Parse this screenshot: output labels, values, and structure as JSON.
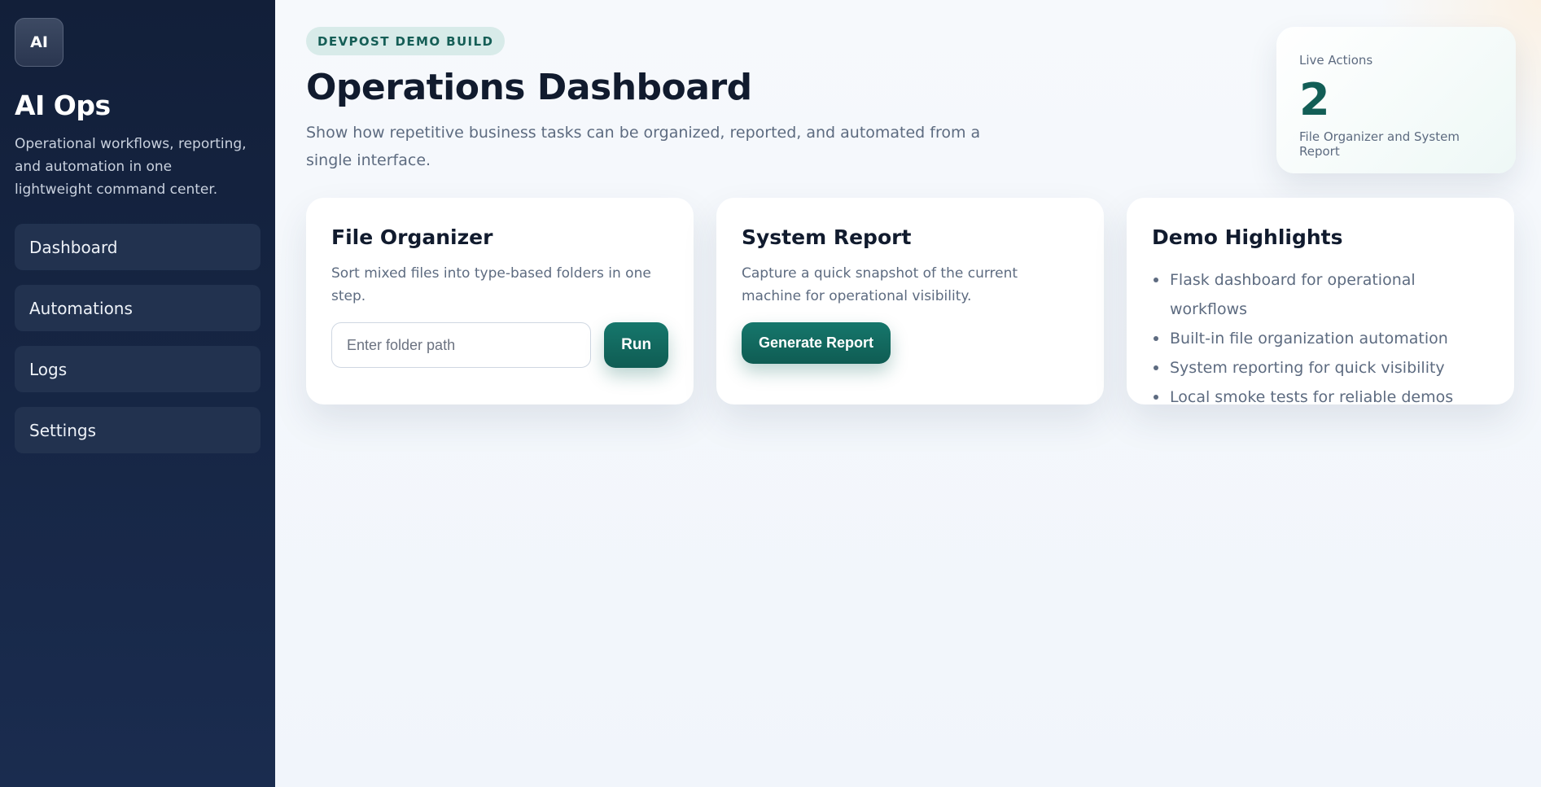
{
  "sidebar": {
    "logo": "AI",
    "title": "AI Ops",
    "description": "Operational workflows, reporting, and automation in one lightweight command center.",
    "nav": [
      "Dashboard",
      "Automations",
      "Logs",
      "Settings"
    ]
  },
  "header": {
    "badge": "DEVPOST DEMO BUILD",
    "title": "Operations Dashboard",
    "description": "Show how repetitive business tasks can be organized, reported, and automated from a single interface."
  },
  "stat": {
    "label": "Live Actions",
    "value": "2",
    "sub": "File Organizer and System Report"
  },
  "file_organizer": {
    "title": "File Organizer",
    "description": "Sort mixed files into type-based folders in one step.",
    "input_placeholder": "Enter folder path",
    "input_value": "",
    "button": "Run"
  },
  "system_report": {
    "title": "System Report",
    "description": "Capture a quick snapshot of the current machine for operational visibility.",
    "button": "Generate Report"
  },
  "highlights": {
    "title": "Demo Highlights",
    "items": [
      "Flask dashboard for operational workflows",
      "Built-in file organization automation",
      "System reporting for quick visibility",
      "Local smoke tests for reliable demos"
    ]
  },
  "colors": {
    "accent": "#125e56",
    "sidebar": "#121f39",
    "text": "#111b2e"
  }
}
